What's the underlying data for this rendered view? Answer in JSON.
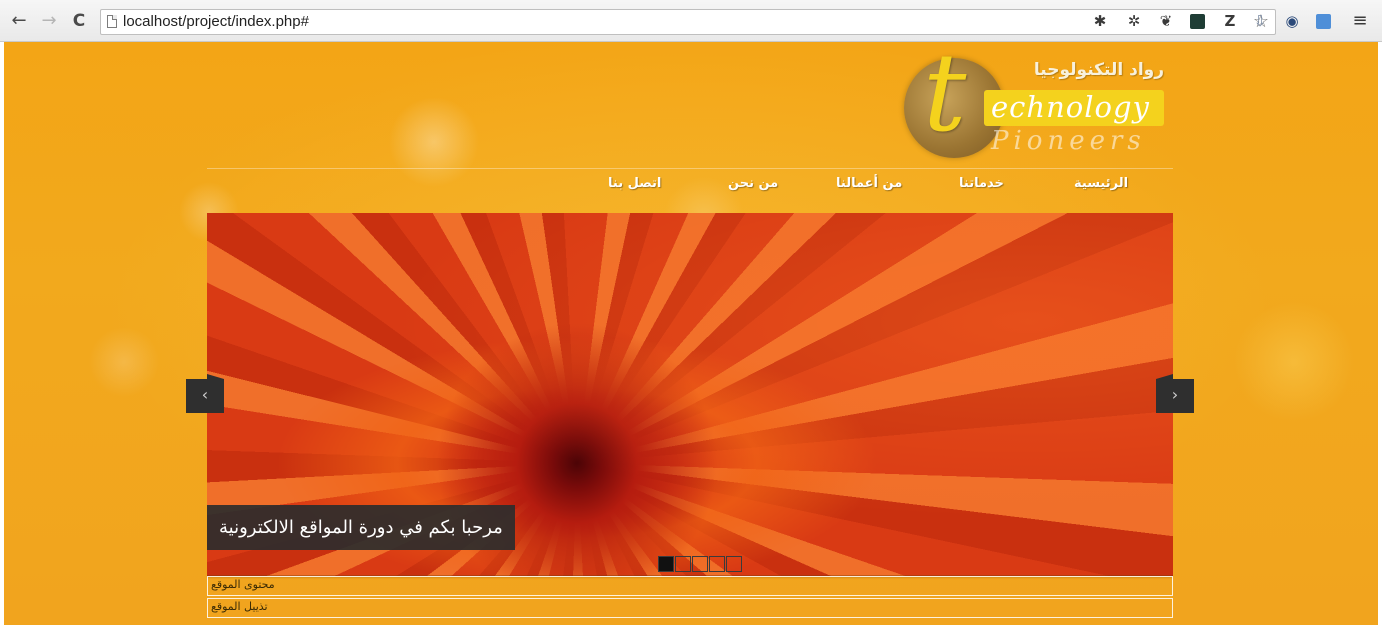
{
  "browser": {
    "url": "localhost/project/index.php#",
    "back_glyph": "←",
    "forward_glyph": "→",
    "reload_glyph": "C",
    "star_glyph": "☆",
    "extensions": [
      "puzzle-icon",
      "bug-icon",
      "paw-icon",
      "dark-app-icon",
      "Z",
      "download-icon",
      "camera-icon",
      "screen-icon"
    ],
    "z_label": "Z",
    "menu_glyph": "≡"
  },
  "site": {
    "logo_arabic": "رواد التكنولوجيا",
    "logo_letter": "t",
    "logo_word1": "echnology",
    "logo_word2": "Pioneers",
    "menu": [
      {
        "label": "الرئيسية"
      },
      {
        "label": "خدماتنا"
      },
      {
        "label": "من أعمالنا"
      },
      {
        "label": "من نحن"
      },
      {
        "label": "اتصل بنا"
      }
    ],
    "slider": {
      "caption": "مرحبا بكم في دورة المواقع الالكترونية",
      "prev_glyph": "‹",
      "next_glyph": "›",
      "dot_count": 5,
      "active_dot": 1
    },
    "content_label": "محتوى الموقع",
    "footer_label": "تذييل الموقع"
  },
  "colors": {
    "page_bg": "#f2a71b",
    "logo_yellow": "#f4d21d",
    "caption_bg": "#2d2d2d"
  }
}
